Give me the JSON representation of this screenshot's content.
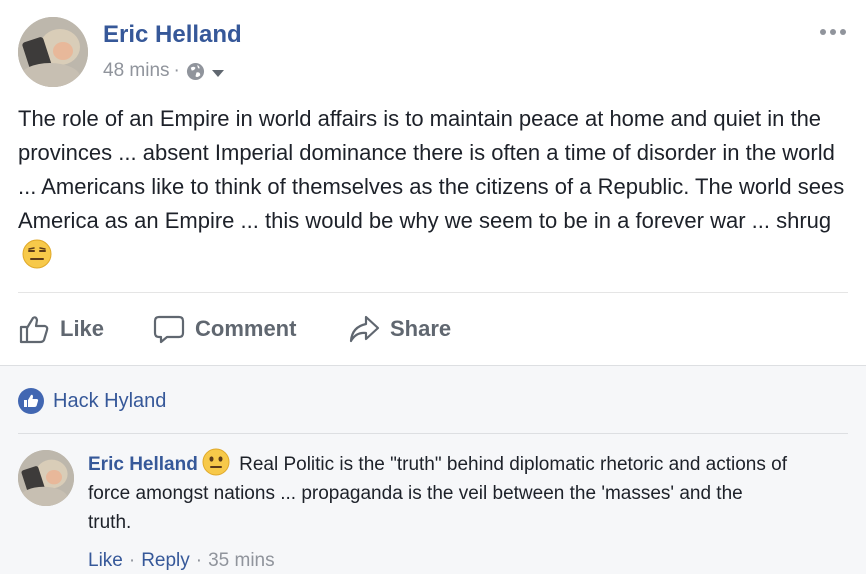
{
  "post": {
    "author": "Eric Helland",
    "time": "48 mins",
    "meta_separator": "·",
    "privacy_icon": "globe-icon",
    "text": "The role of an Empire in world affairs is to maintain peace at home and quiet in the provinces ... absent Imperial dominance there is often a time of disorder in the world ... Americans like to think of themselves as the citizens of a Republic. The world sees America as an Empire ... this would be why we seem to be in a forever war ... shrug",
    "text_emoji": "expressionless-face-emoji"
  },
  "actions": {
    "like_label": "Like",
    "comment_label": "Comment",
    "share_label": "Share"
  },
  "likes": {
    "names": "Hack Hyland"
  },
  "comment": {
    "author": "Eric Helland",
    "emoji": "neutral-face-emoji",
    "text": " Real Politic is the \"truth\" behind diplomatic rhetoric and actions of force amongst nations ... propaganda is the veil between the 'masses' and the truth.",
    "like_label": "Like",
    "reply_label": "Reply",
    "separator": "·",
    "time": "35 mins"
  },
  "colors": {
    "link_blue": "#365899",
    "like_blue": "#4267b2",
    "meta_gray": "#90949c",
    "emoji_yellow": "#f7c94a"
  }
}
